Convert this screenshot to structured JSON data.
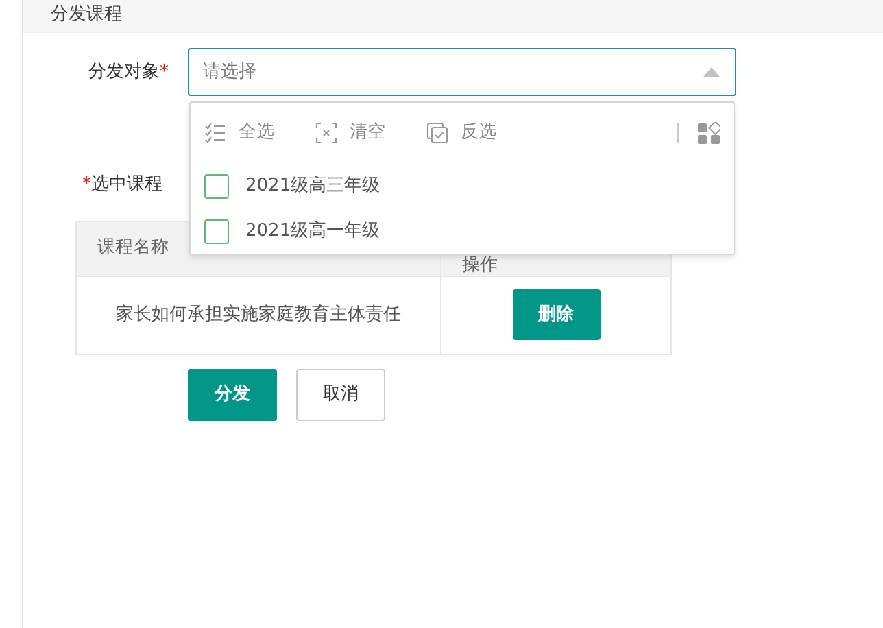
{
  "header": {
    "title": "分发课程"
  },
  "target_field": {
    "label": "分发对象",
    "required_mark": "*",
    "placeholder": "请选择",
    "expanded": true
  },
  "dropdown": {
    "tools": [
      {
        "kind": "select-all",
        "label": "全选"
      },
      {
        "kind": "clear",
        "label": "清空"
      },
      {
        "kind": "invert",
        "label": "反选"
      }
    ],
    "options": [
      {
        "label": "2021级高三年级",
        "checked": false
      },
      {
        "label": "2021级高一年级",
        "checked": false
      }
    ]
  },
  "courses_field": {
    "required_mark": "*",
    "label": "选中课程"
  },
  "table": {
    "columns": [
      "课程名称",
      "操作"
    ],
    "rows": [
      {
        "name": "家长如何承担实施家庭教育主体责任",
        "action": "删除"
      }
    ]
  },
  "buttons": [
    {
      "kind": "primary",
      "label": "分发"
    },
    {
      "kind": "secondary",
      "label": "取消"
    }
  ]
}
